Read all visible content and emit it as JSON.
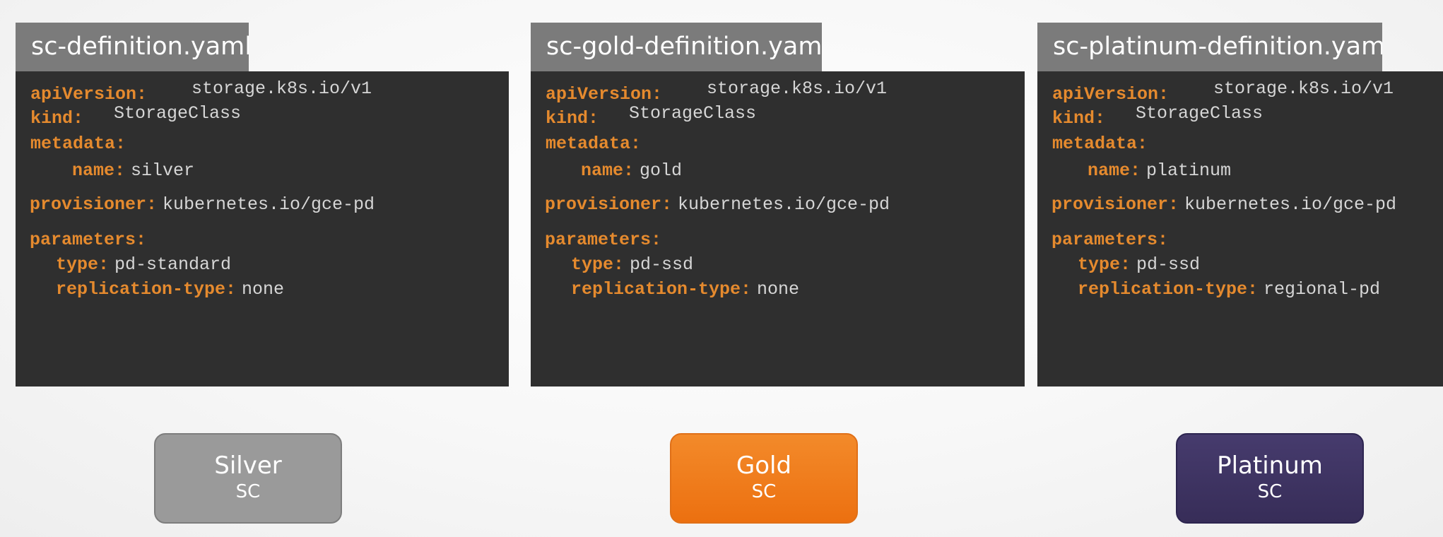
{
  "panels": [
    {
      "filename": "sc-definition.yaml",
      "apiVersion_key": "apiVersion:",
      "apiVersion_val": "storage.k8s.io/v1",
      "kind_key": "kind:",
      "kind_val": "StorageClass",
      "metadata_key": "metadata:",
      "name_key": "name:",
      "name_val": "silver",
      "provisioner_key": "provisioner:",
      "provisioner_val": "kubernetes.io/gce-pd",
      "parameters_key": "parameters:",
      "type_key": "type:",
      "type_val": "pd-standard",
      "replication_key": "replication-type:",
      "replication_val": "none"
    },
    {
      "filename": "sc-gold-definition.yaml",
      "apiVersion_key": "apiVersion:",
      "apiVersion_val": "storage.k8s.io/v1",
      "kind_key": "kind:",
      "kind_val": "StorageClass",
      "metadata_key": "metadata:",
      "name_key": "name:",
      "name_val": "gold",
      "provisioner_key": "provisioner:",
      "provisioner_val": "kubernetes.io/gce-pd",
      "parameters_key": "parameters:",
      "type_key": "type:",
      "type_val": "pd-ssd",
      "replication_key": "replication-type:",
      "replication_val": "none"
    },
    {
      "filename": "sc-platinum-definition.yaml",
      "apiVersion_key": "apiVersion:",
      "apiVersion_val": "storage.k8s.io/v1",
      "kind_key": "kind:",
      "kind_val": "StorageClass",
      "metadata_key": "metadata:",
      "name_key": "name:",
      "name_val": "platinum",
      "provisioner_key": "provisioner:",
      "provisioner_val": "kubernetes.io/gce-pd",
      "parameters_key": "parameters:",
      "type_key": "type:",
      "type_val": "pd-ssd",
      "replication_key": "replication-type:",
      "replication_val": "regional-pd"
    }
  ],
  "badges": [
    {
      "name": "Silver",
      "sub": "SC",
      "color": "#9a9a9a"
    },
    {
      "name": "Gold",
      "sub": "SC",
      "color": "#f07a12"
    },
    {
      "name": "Platinum",
      "sub": "SC",
      "color": "#3e3463"
    }
  ],
  "colors": {
    "code_background": "#2f2f2f",
    "tab_background": "#7b7b7b",
    "yaml_key": "#e58a2e",
    "yaml_value": "#d6d6d6"
  }
}
